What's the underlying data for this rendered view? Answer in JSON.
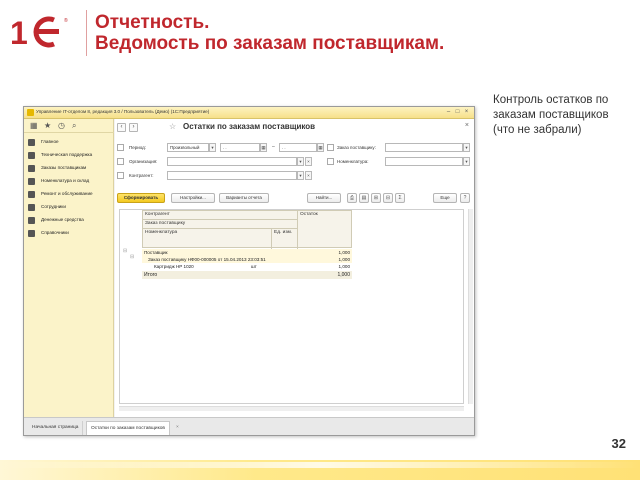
{
  "slide": {
    "title_line1": "Отчетность.",
    "title_line2": "Ведомость по заказам поставщикам.",
    "note": "Контроль остатков по заказам поставщиков (что не забрали)",
    "page_number": "32",
    "brand_color": "#c0272d"
  },
  "app": {
    "window_title": "Управление IT-отделом 8, редакция 3.0 / Пользователь (Демо) (1С:Предприятие)",
    "nav_items": [
      {
        "label": "Главное",
        "icon": "home-icon"
      },
      {
        "label": "Техническая поддержка",
        "icon": "support-icon"
      },
      {
        "label": "Заказы поставщикам",
        "icon": "truck-icon"
      },
      {
        "label": "Номенклатура и склад",
        "icon": "box-icon"
      },
      {
        "label": "Ремонт и обслуживание",
        "icon": "wrench-icon"
      },
      {
        "label": "Сотрудники",
        "icon": "people-icon"
      },
      {
        "label": "Денежные средства",
        "icon": "money-icon"
      },
      {
        "label": "Справочники",
        "icon": "book-icon"
      }
    ],
    "form": {
      "title": "Остатки по заказам поставщиков",
      "period_label": "Период:",
      "period_type": "Произвольный",
      "date_from": "  .  .",
      "date_to": "  .  .",
      "order_label": "Заказ поставщику:",
      "org_label": "Организация:",
      "nomenclature_label": "Номенклатура:",
      "counterparty_label": "Контрагент:",
      "generate_button": "Сформировать",
      "settings_button": "Настройки...",
      "variants_button": "Варианты отчета",
      "find_button": "Найти...",
      "more_button": "Еще"
    },
    "report": {
      "header": {
        "counterparty": "Контрагент",
        "order": "Заказ поставщику",
        "nomenclature": "Номенклатура",
        "unit": "Ед. изм.",
        "balance": "Остаток"
      },
      "rows": [
        {
          "text": "Поставщик",
          "unit": "",
          "value": "1,000"
        },
        {
          "text": "Заказ поставщику НФ00-000005 от 15.04.2013 23:03:51",
          "unit": "",
          "value": "1,000"
        },
        {
          "text": "Картридж HP 1020",
          "unit": "шт",
          "value": "1,000"
        }
      ],
      "total_label": "Итого",
      "total_value": "1,000"
    },
    "tabs": {
      "home": "Начальная страница",
      "current": "Остатки по заказам поставщиков"
    }
  }
}
